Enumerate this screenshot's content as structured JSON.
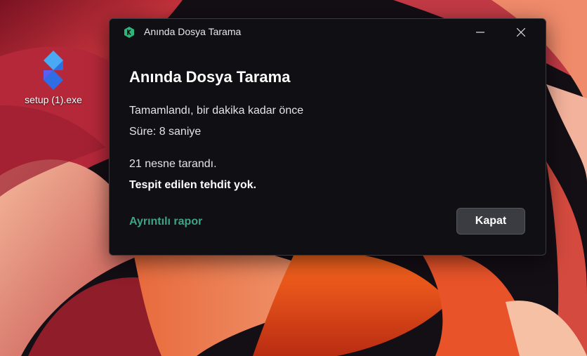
{
  "desktop": {
    "icon_label": "setup (1).exe"
  },
  "dialog": {
    "window_title": "Anında Dosya Tarama",
    "heading": "Anında Dosya Tarama",
    "status_line": "Tamamlandı, bir dakika kadar önce",
    "duration_line": "Süre: 8 saniye",
    "scanned_line": "21 nesne tarandı.",
    "result_line": "Tespit edilen tehdit yok.",
    "report_link": "Ayrıntılı rapor",
    "close_button": "Kapat"
  },
  "colors": {
    "accent_link": "#3fa487",
    "app_icon_green": "#2fb57a",
    "dialog_bg": "#0f0f14",
    "button_bg": "#3b3b42"
  },
  "icons": {
    "app": "kaspersky-k-icon",
    "minimize": "minimize-icon",
    "close": "close-icon",
    "desktop_file": "setup-exe-icon"
  }
}
